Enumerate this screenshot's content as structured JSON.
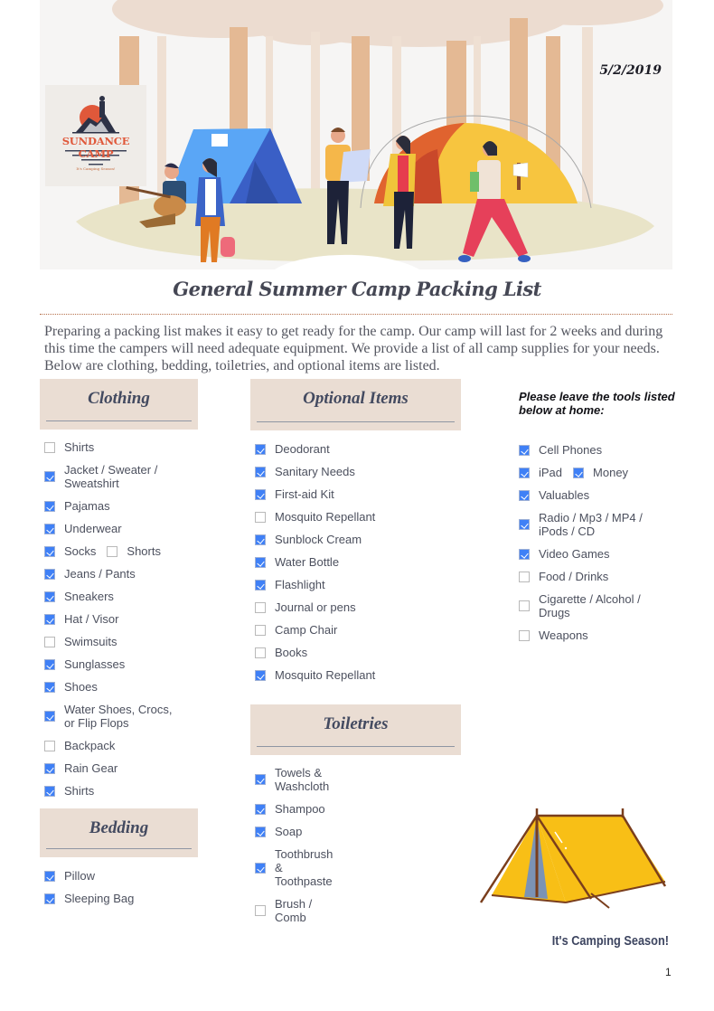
{
  "header": {
    "date": "5/2/2019",
    "logo": {
      "name": "SUNDANCE CAMP",
      "tagline": "It's Camping Season!"
    }
  },
  "title": "General Summer Camp Packing List",
  "intro": "Preparing a packing list makes it easy to get ready for the camp. Our camp will last for 2 weeks and during this time the campers will need adequate equipment. We provide a list of all camp supplies for your needs. Below are clothing, bedding, toiletries, and optional items are listed.",
  "clothing": {
    "title": "Clothing",
    "items": [
      {
        "label": "Shirts",
        "checked": false
      },
      {
        "label": "Jacket / Sweater /\nSweatshirt",
        "checked": true
      },
      {
        "label": "Pajamas",
        "checked": true
      },
      {
        "label": "Underwear",
        "checked": true
      },
      {
        "label": "Socks",
        "checked": true,
        "extra": {
          "label": "Shorts",
          "checked": false
        }
      },
      {
        "label": "Jeans / Pants",
        "checked": true
      },
      {
        "label": "Sneakers",
        "checked": true
      },
      {
        "label": "Hat / Visor",
        "checked": true
      },
      {
        "label": "Swimsuits",
        "checked": false
      },
      {
        "label": "Sunglasses",
        "checked": true
      },
      {
        "label": "Shoes",
        "checked": true
      },
      {
        "label": "Water Shoes, Crocs,\nor Flip Flops",
        "checked": true
      },
      {
        "label": "Backpack",
        "checked": false
      },
      {
        "label": "Rain Gear",
        "checked": true
      },
      {
        "label": "Shirts",
        "checked": true
      }
    ]
  },
  "bedding": {
    "title": "Bedding",
    "items": [
      {
        "label": "Pillow",
        "checked": true
      },
      {
        "label": "Sleeping Bag",
        "checked": true
      }
    ]
  },
  "optional": {
    "title": "Optional Items",
    "items": [
      {
        "label": "Deodorant",
        "checked": true
      },
      {
        "label": "Sanitary Needs",
        "checked": true
      },
      {
        "label": "First-aid Kit",
        "checked": true
      },
      {
        "label": "Mosquito Repellant",
        "checked": false
      },
      {
        "label": "Sunblock Cream",
        "checked": true
      },
      {
        "label": "Water Bottle",
        "checked": true
      },
      {
        "label": "Flashlight",
        "checked": true
      },
      {
        "label": "Journal or pens",
        "checked": false
      },
      {
        "label": "Camp Chair",
        "checked": false
      },
      {
        "label": "Books",
        "checked": false
      },
      {
        "label": "Mosquito Repellant",
        "checked": true
      }
    ]
  },
  "toiletries": {
    "title": "Toiletries",
    "items": [
      {
        "label": "Towels &\nWashcloth",
        "checked": true
      },
      {
        "label": "Shampoo",
        "checked": true
      },
      {
        "label": "Soap",
        "checked": true
      },
      {
        "label": "Toothbrush\n&\nToothpaste",
        "checked": true
      },
      {
        "label": "Brush /\nComb",
        "checked": false
      }
    ]
  },
  "leave_home": {
    "note": "Please leave the tools listed below at home:",
    "items": [
      {
        "label": "Cell Phones",
        "checked": true
      },
      {
        "label": "iPad",
        "checked": true,
        "extra": {
          "label": "Money",
          "checked": true
        }
      },
      {
        "label": "Valuables",
        "checked": true
      },
      {
        "label": "Radio / Mp3 / MP4 /\niPods / CD",
        "checked": true
      },
      {
        "label": "Video Games",
        "checked": true
      },
      {
        "label": "Food / Drinks",
        "checked": false
      },
      {
        "label": "Cigarette / Alcohol /\nDrugs",
        "checked": false
      },
      {
        "label": "Weapons",
        "checked": false
      }
    ]
  },
  "footer": {
    "slogan": "It's Camping Season!",
    "page_number": "1"
  },
  "colors": {
    "section_bg": "#eaddd3",
    "checkbox_checked": "#3f80f6",
    "logo_accent": "#e0583a",
    "heading_text": "#434a60"
  }
}
